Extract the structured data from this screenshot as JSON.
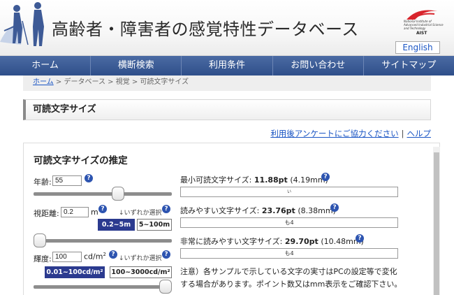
{
  "site": {
    "title": "高齢者・障害者の感覚特性データベース",
    "aist_tagline": "National Institute of Advanced Industrial Science and Technology",
    "aist_name": "AIST",
    "english_label": "English"
  },
  "nav": {
    "items": [
      {
        "label": "ホーム"
      },
      {
        "label": "横断検索"
      },
      {
        "label": "利用条件"
      },
      {
        "label": "お問い合わせ"
      },
      {
        "label": "サイトマップ"
      }
    ]
  },
  "breadcrumb": {
    "home": "ホーム",
    "rest": " > データベース > 視覚 > 可読文字サイズ"
  },
  "section": {
    "title": "可読文字サイズ"
  },
  "links": {
    "survey": "利用後アンケートにご協力ください",
    "separator": "|",
    "help": "ヘルプ"
  },
  "panel": {
    "title": "可読文字サイズの推定"
  },
  "form": {
    "age_label": "年齢:",
    "age_value": "55",
    "age_slider_fraction": 0.62,
    "distance_label": "視距離:",
    "distance_value": "0.2",
    "distance_unit": "m",
    "distance_note": "↓いずれか選択",
    "distance_options": [
      {
        "label": "0.2~5m",
        "selected": true
      },
      {
        "label": "5~100m",
        "selected": false
      }
    ],
    "distance_slider_fraction": 0.0,
    "luminance_label": "輝度:",
    "luminance_value": "100",
    "luminance_unit": "cd/m",
    "luminance_unit_sup": "2",
    "luminance_note": "↓いずれか選択",
    "luminance_options": [
      {
        "label": "0.01~100cd/m²",
        "selected": true
      },
      {
        "label": "100~3000cd/m²",
        "selected": false
      }
    ],
    "luminance_slider_fraction": 1.0,
    "help_glyph": "?"
  },
  "results": {
    "min_label": "最小可読文字サイズ:",
    "min_pt": "11.88pt",
    "min_mm": "(4.19mm)",
    "min_sample": "い",
    "easy_label": "読みやすい文字サイズ:",
    "easy_pt": "23.76pt",
    "easy_mm": "(8.38mm)",
    "easy_sample": "も4",
    "very_label": "非常に読みやすい文字サイズ:",
    "very_pt": "29.70pt",
    "very_mm": "(10.48mm)",
    "very_sample": "も4"
  },
  "note": "注意）各サンプルで示している文字の実寸はPCの設定等で変化する場合があります。ポイント数又はmm表示をご確認下さい。",
  "colors": {
    "nav": "#2f4f8a",
    "selected_option": "#2b3a8f",
    "help_icon": "#2d54b0",
    "link": "#1a55c4"
  }
}
